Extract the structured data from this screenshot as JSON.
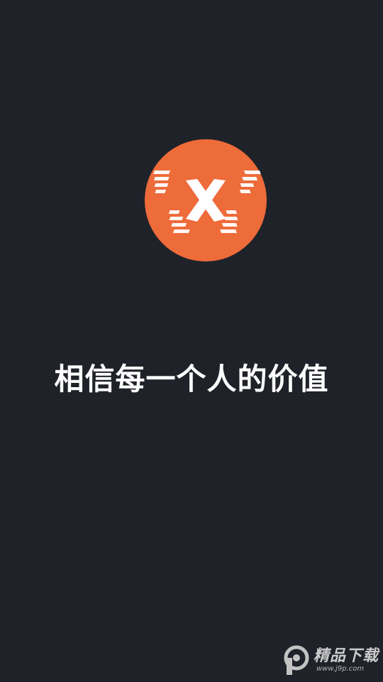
{
  "app": {
    "slogan": "相信每一个人的价值",
    "logo_icon": "x-brand-logo-icon",
    "logo_color": "#ee6b3a",
    "background_color": "#1f2228"
  },
  "watermark": {
    "icon": "p-logo-icon",
    "title": "精品下载",
    "url": "www.j9p.com"
  }
}
